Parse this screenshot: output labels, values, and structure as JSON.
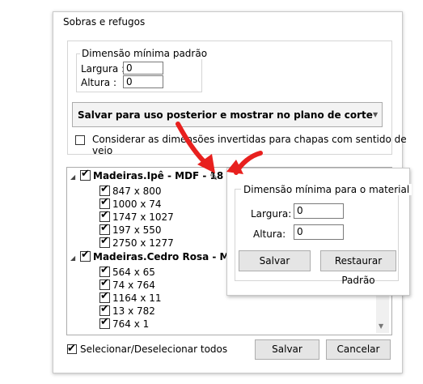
{
  "window": {
    "title": "Sobras e refugos"
  },
  "default_dimension": {
    "legend": "Dimensão mínima padrão",
    "width_label": "Largura :",
    "width_value": "0",
    "height_label": "Altura :",
    "height_value": "0"
  },
  "mode_select": {
    "value": "Salvar para uso posterior e mostrar no plano de corte"
  },
  "consider_inverted": {
    "label": "Considerar as dimensões invertidas para chapas com sentido de veio",
    "checked": false
  },
  "tree": {
    "nodes": [
      {
        "label": "Madeiras.Ipê - MDF - 18",
        "items": [
          "847 x 800",
          "1000 x 74",
          "1747 x 1027",
          "197 x 550",
          "2750 x 1277"
        ]
      },
      {
        "label": "Madeiras.Cedro Rosa - MDF",
        "items": [
          "564 x 65",
          "74 x 764",
          "1164 x 11",
          "13 x 782",
          "764 x 1"
        ]
      }
    ]
  },
  "popup": {
    "legend": "Dimensão mínima para o material",
    "width_label": "Largura:",
    "width_value": "0",
    "height_label": "Altura:",
    "height_value": "0",
    "save_label": "Salvar",
    "restore_label": "Restaurar Padrão"
  },
  "footer": {
    "select_all_label": "Selecionar/Deselecionar todos",
    "select_all_checked": true,
    "save_label": "Salvar",
    "cancel_label": "Cancelar"
  },
  "colors": {
    "annotation_arrow": "#e8201e",
    "button_bg": "#e5e5e5"
  },
  "icons": {
    "edit": "pencil-icon",
    "expand": "expand-arrow-icon",
    "combo": "chevron-down-icon"
  }
}
